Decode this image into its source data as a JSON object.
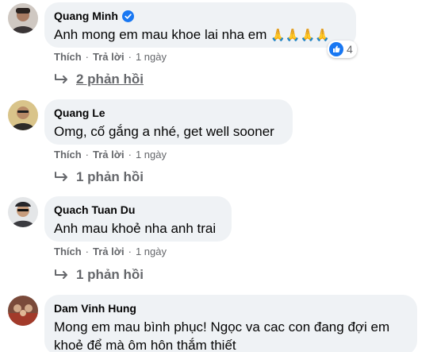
{
  "colors": {
    "bubble_bg": "#eff2f5",
    "meta_text": "#65676b",
    "verified_blue": "#1877f2",
    "like_blue": "#1877f2"
  },
  "comments": [
    {
      "author": "Quang Minh",
      "verified": true,
      "text": "Anh mong em mau khoe lai nha em",
      "emoji": "🙏🙏🙏🙏",
      "like_label": "Thích",
      "reply_label": "Trả lời",
      "time": "1 ngày",
      "reaction_count": "4",
      "replies_label": "2 phản hồi"
    },
    {
      "author": "Quang Le",
      "verified": false,
      "text": "Omg, cố gắng a nhé, get well sooner",
      "like_label": "Thích",
      "reply_label": "Trả lời",
      "time": "1 ngày",
      "replies_label": "1 phản hồi"
    },
    {
      "author": "Quach Tuan Du",
      "verified": false,
      "text": "Anh mau khoẻ nha anh trai",
      "like_label": "Thích",
      "reply_label": "Trả lời",
      "time": "1 ngày",
      "replies_label": "1 phản hồi"
    },
    {
      "author": "Dam Vinh Hung",
      "verified": false,
      "text_line1": "Mong em mau bình phục! Ngọc va cac con đang đợi em",
      "text_line2": "khoẻ để mà ôm hôn thắm thiết"
    }
  ],
  "icons": {
    "verified": "verified-badge-icon",
    "like": "like-thumb-icon",
    "reply_arrow": "reply-arrow-icon"
  }
}
